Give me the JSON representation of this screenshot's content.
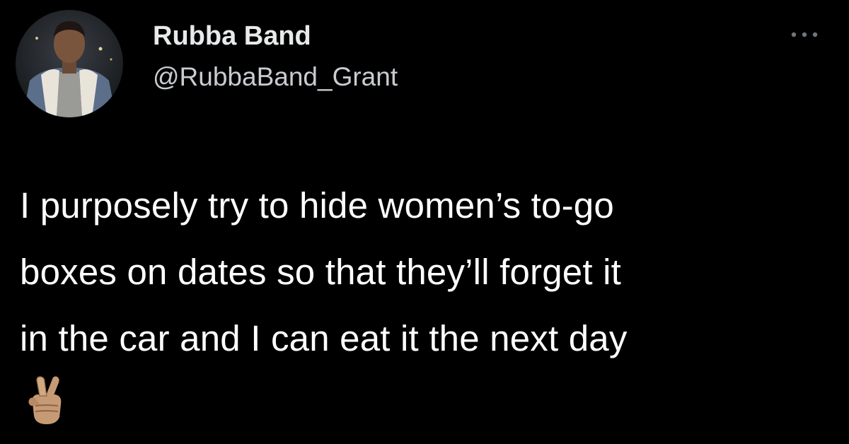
{
  "author": {
    "name": "Rubba Band",
    "handle": "@RubbaBand_Grant",
    "avatar_icon": "profile-photo"
  },
  "tweet": {
    "lines": [
      "I purposely try to hide women’s to-go",
      "boxes on dates so that they’ll forget it",
      "in the car and I can eat it the next day"
    ],
    "emoji": "🤞🏽",
    "emoji_icon": "crossed-fingers-icon"
  },
  "actions": {
    "more_icon": "more-options-icon"
  },
  "colors": {
    "background": "#000000",
    "text": "#ffffff",
    "handle": "#c8ccd0"
  }
}
